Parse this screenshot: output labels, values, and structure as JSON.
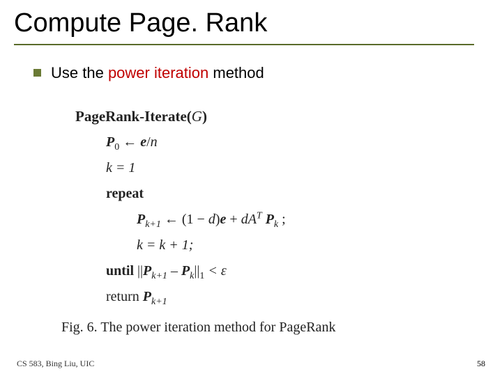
{
  "title": "Compute Page. Rank",
  "bullet": {
    "pre": "Use the ",
    "highlight": "power iteration",
    "post": " method"
  },
  "algo": {
    "header_name": "PageRank-Iterate",
    "header_arg": "G",
    "init_P_lhs": "P",
    "init_P_sub": "0",
    "init_P_rhs_left": " ← ",
    "init_P_e": "e",
    "init_P_slash": "/",
    "init_P_n": "n",
    "k_init": "k = 1",
    "repeat": "repeat",
    "update_Pk1_lhs_P": "P",
    "update_Pk1_lhs_sub": "k+1",
    "update_arrow": " ← (1 − ",
    "update_d1": "d",
    "update_paren_e": ")",
    "update_e": "e",
    "update_plus": " + ",
    "update_d2": "d",
    "update_A": "A",
    "update_T": "T",
    "update_Pk_P": " P",
    "update_Pk_sub": "k",
    "update_tail": " ;",
    "k_incr": "k = k + 1;",
    "until_word": "until",
    "until_pre": " ||",
    "until_P1": "P",
    "until_P1_sub": "k+1",
    "until_minus": " – ",
    "until_P2": "P",
    "until_P2_sub": "k",
    "until_norm": "||",
    "until_norm_sub": "1",
    "until_cmp": " < ε",
    "return_word": "return ",
    "return_P": "P",
    "return_sub": "k+1"
  },
  "caption": "Fig. 6. The power iteration method for PageRank",
  "footer_left": "CS 583, Bing Liu, UIC",
  "footer_right": "58"
}
